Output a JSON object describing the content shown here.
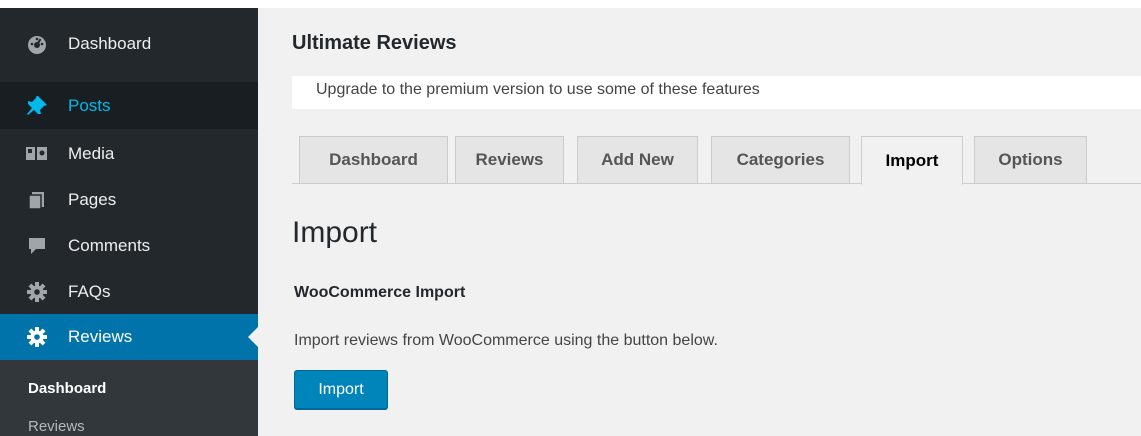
{
  "sidebar": {
    "items": [
      {
        "label": "Dashboard",
        "icon": "dashboard-icon"
      },
      {
        "label": "Posts",
        "icon": "pushpin-icon"
      },
      {
        "label": "Media",
        "icon": "media-icon"
      },
      {
        "label": "Pages",
        "icon": "pages-icon"
      },
      {
        "label": "Comments",
        "icon": "comment-icon"
      },
      {
        "label": "FAQs",
        "icon": "gear-icon"
      },
      {
        "label": "Reviews",
        "icon": "gear-icon"
      }
    ],
    "submenu": [
      {
        "label": "Dashboard"
      },
      {
        "label": "Reviews"
      }
    ],
    "colors": {
      "bg": "#23282d",
      "active": "#0073aa",
      "hover": "#00b9eb"
    }
  },
  "main": {
    "plugin_title": "Ultimate Reviews",
    "notice": "Upgrade to the premium version to use some of these features",
    "tabs": [
      {
        "label": "Dashboard"
      },
      {
        "label": "Reviews"
      },
      {
        "label": "Add New"
      },
      {
        "label": "Categories"
      },
      {
        "label": "Import",
        "active": true
      },
      {
        "label": "Options"
      }
    ],
    "heading": "Import",
    "section_title": "WooCommerce Import",
    "description": "Import reviews from WooCommerce using the button below.",
    "import_button": "Import",
    "colors": {
      "button": "#0085ba"
    }
  }
}
